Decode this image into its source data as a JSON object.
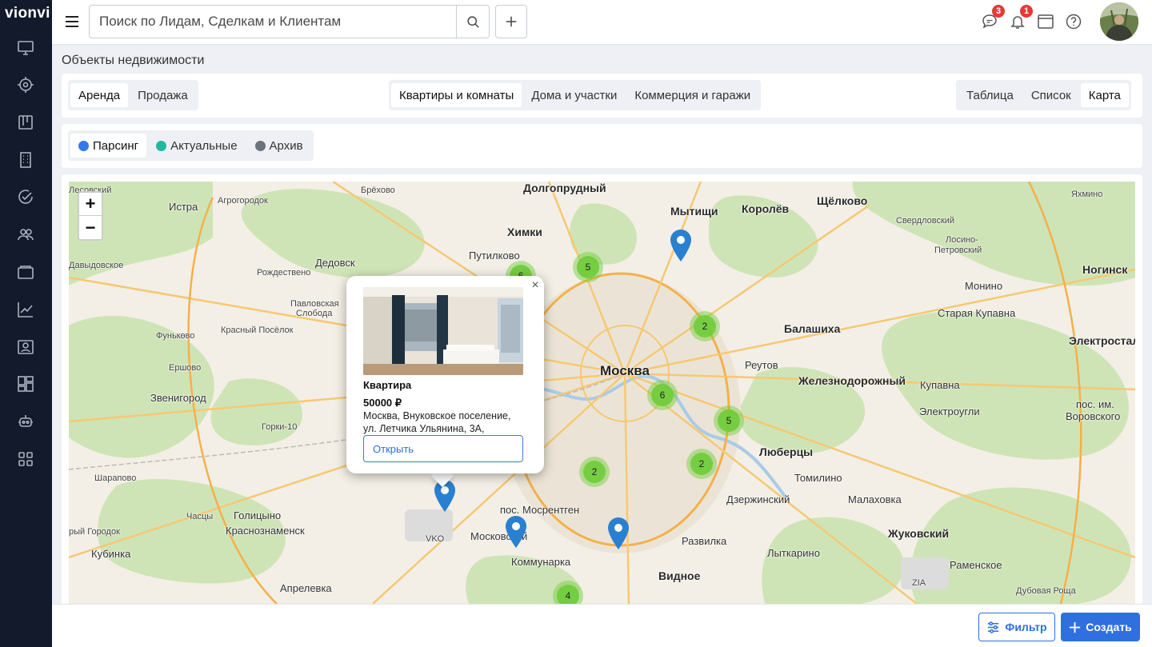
{
  "app": {
    "logo": "vionvi"
  },
  "sidebar": {
    "items": [
      {
        "icon": "monitor-icon"
      },
      {
        "icon": "target-icon"
      },
      {
        "icon": "kanban-icon"
      },
      {
        "icon": "building-icon"
      },
      {
        "icon": "check-circle-icon"
      },
      {
        "icon": "users-icon"
      },
      {
        "icon": "folder-icon"
      },
      {
        "icon": "chart-icon"
      },
      {
        "icon": "contact-card-icon"
      },
      {
        "icon": "dashboard-icon"
      },
      {
        "icon": "robot-icon"
      },
      {
        "icon": "apps-grid-icon"
      }
    ]
  },
  "topbar": {
    "search_placeholder": "Поиск по Лидам, Сделкам и Клиентам",
    "chat_badge": "3",
    "notify_badge": "1"
  },
  "page": {
    "title": "Объекты недвижимости"
  },
  "deal_tabs": [
    {
      "label": "Аренда",
      "active": true
    },
    {
      "label": "Продажа",
      "active": false
    }
  ],
  "type_tabs": [
    {
      "label": "Квартиры и комнаты",
      "active": true
    },
    {
      "label": "Дома и участки",
      "active": false
    },
    {
      "label": "Коммерция и гаражи",
      "active": false
    }
  ],
  "view_tabs": [
    {
      "label": "Таблица",
      "active": false
    },
    {
      "label": "Список",
      "active": false
    },
    {
      "label": "Карта",
      "active": true
    }
  ],
  "status_tabs": [
    {
      "label": "Парсинг",
      "color": "#3477f2",
      "active": true
    },
    {
      "label": "Актуальные",
      "color": "#1fb8a0",
      "active": false
    },
    {
      "label": "Архив",
      "color": "#6c727a",
      "active": false
    }
  ],
  "map": {
    "zoom_in": "+",
    "zoom_out": "−",
    "places": [
      {
        "text": "Долгопрудный",
        "cls": "big"
      },
      {
        "text": "Мытищи",
        "cls": "big"
      },
      {
        "text": "Королёв",
        "cls": "big"
      },
      {
        "text": "Щёлково",
        "cls": "big"
      },
      {
        "text": "Химки",
        "cls": "big"
      },
      {
        "text": "Москва",
        "cls": "city"
      },
      {
        "text": "Балашиха",
        "cls": "big"
      },
      {
        "text": "Реутов",
        "cls": ""
      },
      {
        "text": "Железнодорожный",
        "cls": "big"
      },
      {
        "text": "Люберцы",
        "cls": "big"
      },
      {
        "text": "Электросталь",
        "cls": "big"
      },
      {
        "text": "Ногинск",
        "cls": "big"
      },
      {
        "text": "Истра",
        "cls": ""
      },
      {
        "text": "Дедовск",
        "cls": ""
      },
      {
        "text": "Путилково",
        "cls": ""
      },
      {
        "text": "Звенигород",
        "cls": ""
      },
      {
        "text": "Голицыно",
        "cls": ""
      },
      {
        "text": "Краснознаменск",
        "cls": ""
      },
      {
        "text": "Московский",
        "cls": ""
      },
      {
        "text": "Коммунарка",
        "cls": ""
      },
      {
        "text": "Видное",
        "cls": "big"
      },
      {
        "text": "Развилка",
        "cls": ""
      },
      {
        "text": "Дзержинский",
        "cls": ""
      },
      {
        "text": "Томилино",
        "cls": ""
      },
      {
        "text": "Малаховка",
        "cls": ""
      },
      {
        "text": "Жуковский",
        "cls": "big"
      },
      {
        "text": "Лыткарино",
        "cls": ""
      },
      {
        "text": "Раменское",
        "cls": ""
      },
      {
        "text": "Апрелевка",
        "cls": ""
      },
      {
        "text": "Кубинка",
        "cls": ""
      },
      {
        "text": "пос. Мосрентген",
        "cls": ""
      },
      {
        "text": "Купавна",
        "cls": ""
      },
      {
        "text": "Электроугли",
        "cls": ""
      },
      {
        "text": "пос. им.",
        "cls": ""
      },
      {
        "text": "Воровского",
        "cls": ""
      },
      {
        "text": "Монино",
        "cls": ""
      },
      {
        "text": "Старая Купавна",
        "cls": ""
      },
      {
        "text": "Свердловский",
        "cls": "small"
      },
      {
        "text": "Лосино-",
        "cls": "small"
      },
      {
        "text": "Петровский",
        "cls": "small"
      },
      {
        "text": "Брёхово",
        "cls": "small"
      },
      {
        "text": "Агрогородок",
        "cls": "small"
      },
      {
        "text": "Лесовский",
        "cls": "small"
      },
      {
        "text": "Давыдовское",
        "cls": "small"
      },
      {
        "text": "Рождествено",
        "cls": "small"
      },
      {
        "text": "Павловская",
        "cls": "small"
      },
      {
        "text": "Слобода",
        "cls": "small"
      },
      {
        "text": "Красный Посёлок",
        "cls": "small"
      },
      {
        "text": "Фунькөво",
        "cls": "small"
      },
      {
        "text": "Ершово",
        "cls": "small"
      },
      {
        "text": "Горки-10",
        "cls": "small"
      },
      {
        "text": "Шарапово",
        "cls": "small"
      },
      {
        "text": "Часцы",
        "cls": "small"
      },
      {
        "text": "рый Городок",
        "cls": "small"
      },
      {
        "text": "Яхмино",
        "cls": "small"
      },
      {
        "text": "VKO",
        "cls": "small"
      },
      {
        "text": "ZIA",
        "cls": "small"
      },
      {
        "text": "Дубовая Роща",
        "cls": "small"
      },
      {
        "text": "Лесовский",
        "cls": "small"
      }
    ],
    "clusters": [
      {
        "count": "5"
      },
      {
        "count": "6"
      },
      {
        "count": "2"
      },
      {
        "count": "6"
      },
      {
        "count": "5"
      },
      {
        "count": "2"
      },
      {
        "count": "2"
      },
      {
        "count": "4"
      }
    ]
  },
  "popup": {
    "type": "Квартира",
    "price": "50000 ₽",
    "address": "Москва, Внуковское поселение, ул. Летчика Ульянина, 3А,",
    "open_label": "Открыть",
    "close": "×"
  },
  "bottom": {
    "filter_label": "Фильтр",
    "create_label": "Создать"
  }
}
